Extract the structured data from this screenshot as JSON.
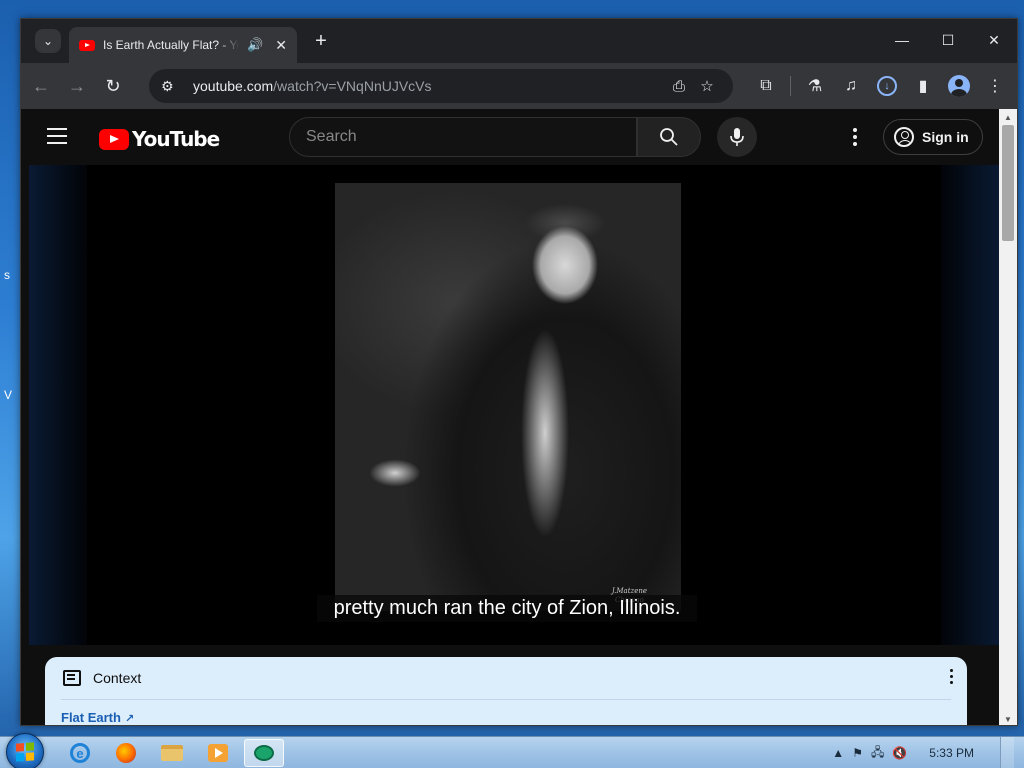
{
  "browser": {
    "tab_title": "Is Earth Actually Flat? - YouTube",
    "new_tab_label": "+",
    "url_host": "youtube.com",
    "url_path": "/watch?v=VNqNnUJVcVs",
    "window_controls": {
      "minimize": "—",
      "maximize": "☐",
      "close": "✕"
    }
  },
  "youtube": {
    "logo_text": "YouTube",
    "search_placeholder": "Search",
    "sign_in_label": "Sign in",
    "subtitle": "pretty much ran the city of Zion, Illinois.",
    "photo_stamp": "J.Matzene\nChicago",
    "context": {
      "title": "Context",
      "link": "Flat Earth"
    }
  },
  "taskbar": {
    "clock": "5:33 PM",
    "active_app": "chat"
  },
  "colors": {
    "youtube_red": "#ff0000",
    "chrome_dark": "#202124",
    "context_bg": "#dcedfb"
  }
}
